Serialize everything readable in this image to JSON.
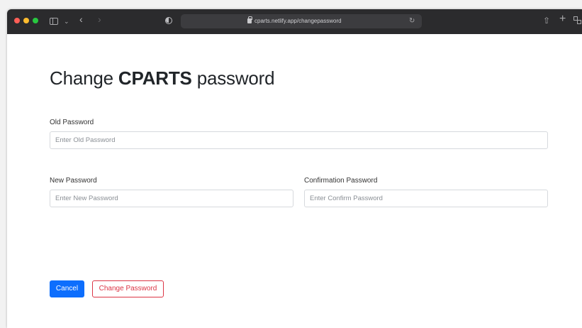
{
  "browser": {
    "url": "cparts.netlify.app/changepassword",
    "icons": [
      "sidebar-icon",
      "chevron-down-icon",
      "back-icon",
      "forward-icon",
      "privacy-shield-icon",
      "lock-icon",
      "reload-icon",
      "share-icon",
      "new-tab-icon",
      "tab-overview-icon"
    ]
  },
  "page": {
    "title_prefix": "Change ",
    "title_bold": "CPARTS",
    "title_suffix": " password"
  },
  "form": {
    "old_password": {
      "label": "Old Password",
      "placeholder": "Enter Old Password",
      "value": ""
    },
    "new_password": {
      "label": "New Password",
      "placeholder": "Enter New Password",
      "value": ""
    },
    "confirm_password": {
      "label": "Confirmation Password",
      "placeholder": "Enter Confirm Password",
      "value": ""
    }
  },
  "actions": {
    "cancel_label": "Cancel",
    "change_label": "Change Password"
  },
  "colors": {
    "primary": "#0d6efd",
    "danger": "#dc3545",
    "titlebar": "#2b2b2d"
  }
}
